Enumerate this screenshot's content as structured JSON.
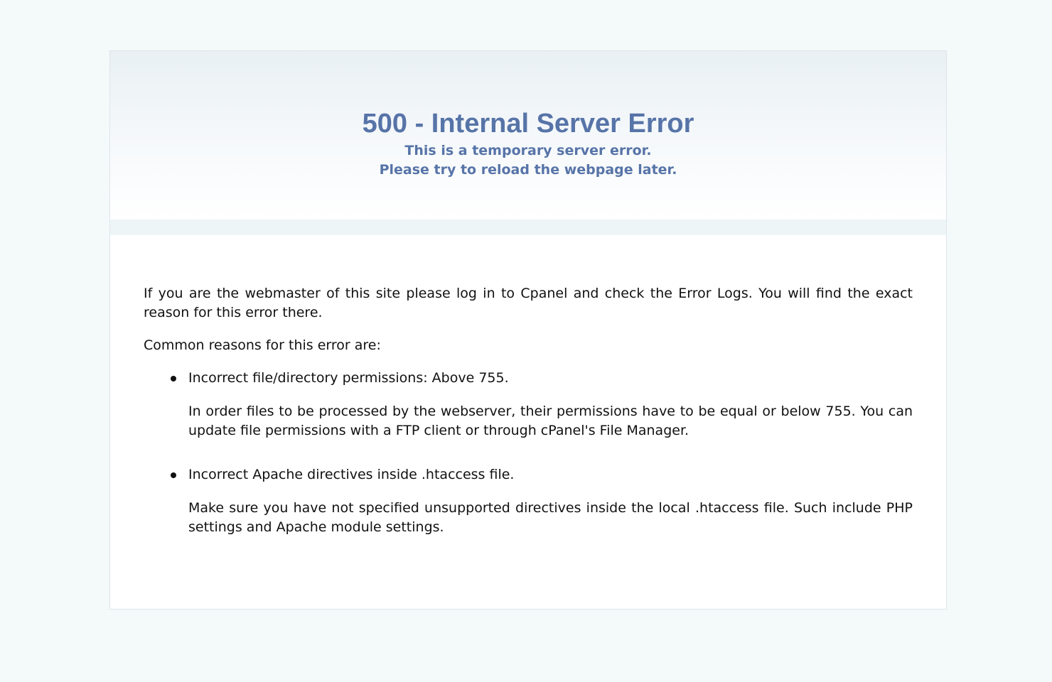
{
  "header": {
    "title": "500 - Internal Server Error",
    "subtitle_line1": "This is a temporary server error.",
    "subtitle_line2": "Please try to reload the webpage later."
  },
  "body": {
    "intro": "If you are the webmaster of this site please log in to Cpanel and check the Error Logs. You will find the exact reason for this error there.",
    "reasons_heading": "Common reasons for this error are:",
    "reasons": [
      {
        "title": "Incorrect file/directory permissions: Above 755.",
        "detail": "In order files to be processed by the webserver, their permissions have to be equal or below 755. You can update file permissions with a FTP client or through cPanel's File Manager."
      },
      {
        "title": "Incorrect Apache directives inside .htaccess file.",
        "detail": "Make sure you have not specified unsupported directives inside the local .htaccess file. Such include PHP settings and Apache module settings."
      }
    ]
  },
  "colors": {
    "background": "#f4f9f9",
    "accent": "#5774a8",
    "text": "#111111",
    "card": "#ffffff"
  }
}
